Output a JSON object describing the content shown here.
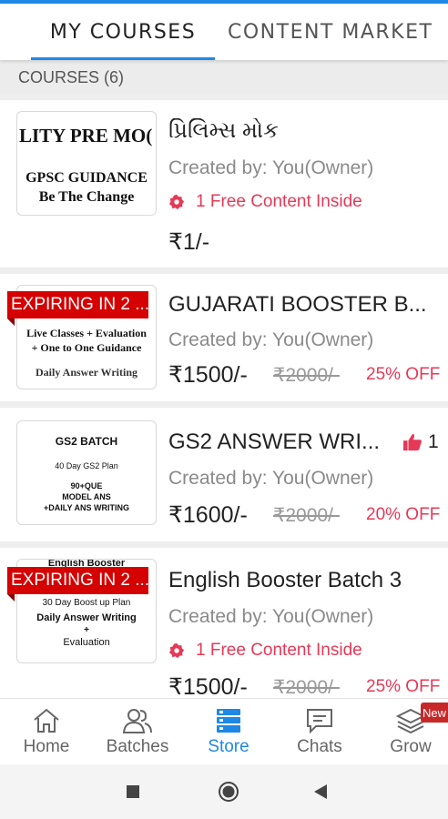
{
  "tabs": [
    {
      "label": "MY COURSES",
      "active": true
    },
    {
      "label": "CONTENT MARKET",
      "active": false
    }
  ],
  "section": {
    "label": "COURSES (6)"
  },
  "courses": [
    {
      "title": "પ્રિલિમ્સ મોક",
      "creator": "Created by: You(Owner)",
      "free_content": "1 Free Content Inside",
      "price": "₹1/-",
      "thumb_lines": [
        "LITY PRE MO(",
        "GPSC GUIDANCE",
        "Be The Change"
      ]
    },
    {
      "title": "GUJARATI BOOSTER B...",
      "creator": "Created by: You(Owner)",
      "ribbon": "EXPIRING IN 2 ...",
      "price": "₹1500/-",
      "original_price": "₹2000/-",
      "discount": "25% OFF",
      "thumb_lines": [
        "Live Classes + Evaluation",
        "+ One to One Guidance",
        "Daily Answer Writing"
      ]
    },
    {
      "title": "GS2 ANSWER WRI...",
      "creator": "Created by: You(Owner)",
      "likes": "1",
      "price": "₹1600/-",
      "original_price": "₹2000/-",
      "discount": "20% OFF",
      "thumb_lines": [
        "GS2 BATCH",
        "40 Day GS2 Plan",
        "90+QUE",
        "MODEL ANS",
        "+DAILY ANS WRITING"
      ]
    },
    {
      "title": "English Booster Batch 3",
      "creator": "Created by: You(Owner)",
      "ribbon": "EXPIRING IN 2 ...",
      "free_content": "1 Free Content Inside",
      "price": "₹1500/-",
      "original_price": "₹2000/-",
      "discount": "25% OFF",
      "thumb_lines": [
        "English Booster",
        "30 Day Boost up Plan",
        "Daily Answer Writing",
        "+",
        "Evaluation"
      ]
    }
  ],
  "bottom_nav": [
    {
      "label": "Home",
      "icon": "home-icon",
      "active": false
    },
    {
      "label": "Batches",
      "icon": "batches-icon",
      "active": false
    },
    {
      "label": "Store",
      "icon": "store-icon",
      "active": true
    },
    {
      "label": "Chats",
      "icon": "chats-icon",
      "active": false
    },
    {
      "label": "Grow",
      "icon": "grow-icon",
      "active": false,
      "badge": "New"
    }
  ],
  "colors": {
    "accent": "#1e88e5",
    "discount": "#e53957",
    "ribbon": "#d50000"
  }
}
